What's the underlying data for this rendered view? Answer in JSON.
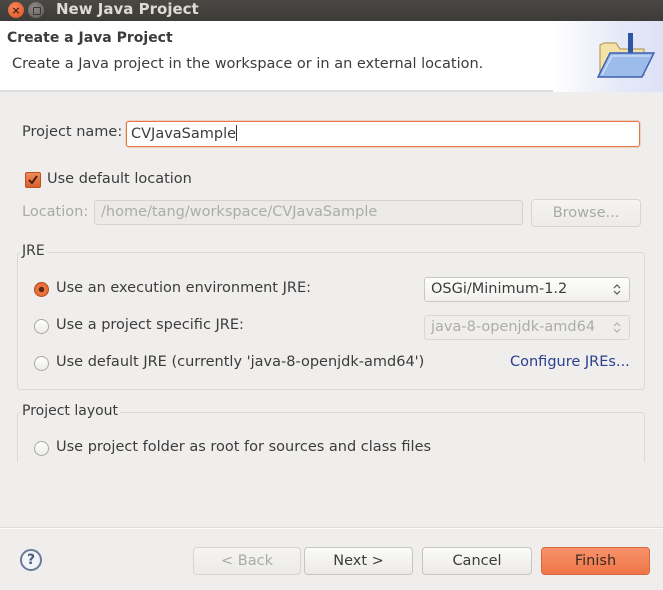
{
  "window": {
    "title": "New Java Project",
    "controls": [
      "close",
      "minimize"
    ]
  },
  "header": {
    "title": "Create a Java Project",
    "description": "Create a Java project in the workspace or in an external location.",
    "icon": "new-java-project-folder-icon"
  },
  "form": {
    "project_name_label": "Project name:",
    "project_name_value": "CVJavaSample",
    "use_default_location_label": "Use default location",
    "use_default_location_checked": true,
    "location_label": "Location:",
    "location_value": "/home/tang/workspace/CVJavaSample",
    "browse_label": "Browse..."
  },
  "jre": {
    "group_title": "JRE",
    "options": [
      {
        "label": "Use an execution environment JRE:",
        "selected": true
      },
      {
        "label": "Use a project specific JRE:",
        "selected": false
      },
      {
        "label": "Use default JRE (currently 'java-8-openjdk-amd64')",
        "selected": false
      }
    ],
    "execution_env_value": "OSGi/Minimum-1.2",
    "project_specific_value": "java-8-openjdk-amd64",
    "configure_link": "Configure JREs..."
  },
  "layout": {
    "group_title": "Project layout",
    "options": [
      {
        "label": "Use project folder as root for sources and class files",
        "selected": false
      }
    ]
  },
  "footer": {
    "help_glyph": "?",
    "back_label": "< Back",
    "next_label": "Next >",
    "cancel_label": "Cancel",
    "finish_label": "Finish"
  },
  "colors": {
    "accent": "#ef7548",
    "link": "#2a3f8f",
    "titlebar": "#3c3b37"
  }
}
